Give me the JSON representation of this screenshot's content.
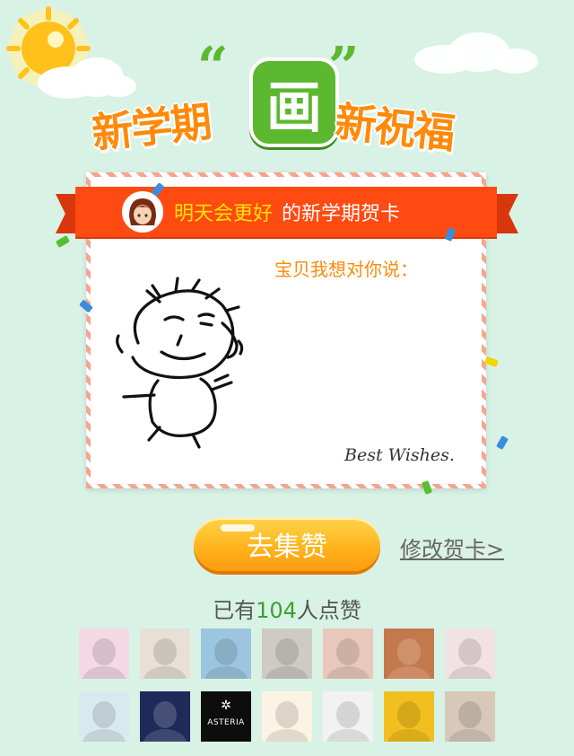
{
  "header": {
    "title_left": "新学期",
    "title_badge": "画",
    "title_right": "新祝福",
    "quote_left": "“",
    "quote_right": "”"
  },
  "card": {
    "sender_name": "明天会更好",
    "title_suffix": "的新学期贺卡",
    "message_label": "宝贝我想对你说：",
    "signature": "Best Wishes."
  },
  "actions": {
    "collect_label": "去集赞",
    "edit_label": "修改贺卡>"
  },
  "likes": {
    "prefix": "已有",
    "count": "104",
    "suffix": "人点赞"
  },
  "avatars": [
    {
      "name": "avatar-anime-girl",
      "color": "#f4d9e4"
    },
    {
      "name": "avatar-child",
      "color": "#e8e0d6"
    },
    {
      "name": "avatar-seaside",
      "color": "#9cc6e0"
    },
    {
      "name": "avatar-sketch",
      "color": "#cfcac4"
    },
    {
      "name": "avatar-face-closeup",
      "color": "#e9c8bc"
    },
    {
      "name": "avatar-couple",
      "color": "#c4794c"
    },
    {
      "name": "avatar-girl-bangs",
      "color": "#f2e2e4"
    },
    {
      "name": "avatar-watercolor",
      "color": "#d8eaf0"
    },
    {
      "name": "avatar-dark-portrait",
      "color": "#1e2a5a"
    },
    {
      "name": "avatar-asteria-logo",
      "color": "#0d0d0d",
      "text": "ASTERIA"
    },
    {
      "name": "avatar-cartoon-pair",
      "color": "#fbf3e3"
    },
    {
      "name": "avatar-teal-hair",
      "color": "#f2f2f2"
    },
    {
      "name": "avatar-yellow-bear",
      "color": "#f2c01e"
    },
    {
      "name": "avatar-photo-beach",
      "color": "#d7c8b8"
    }
  ]
}
